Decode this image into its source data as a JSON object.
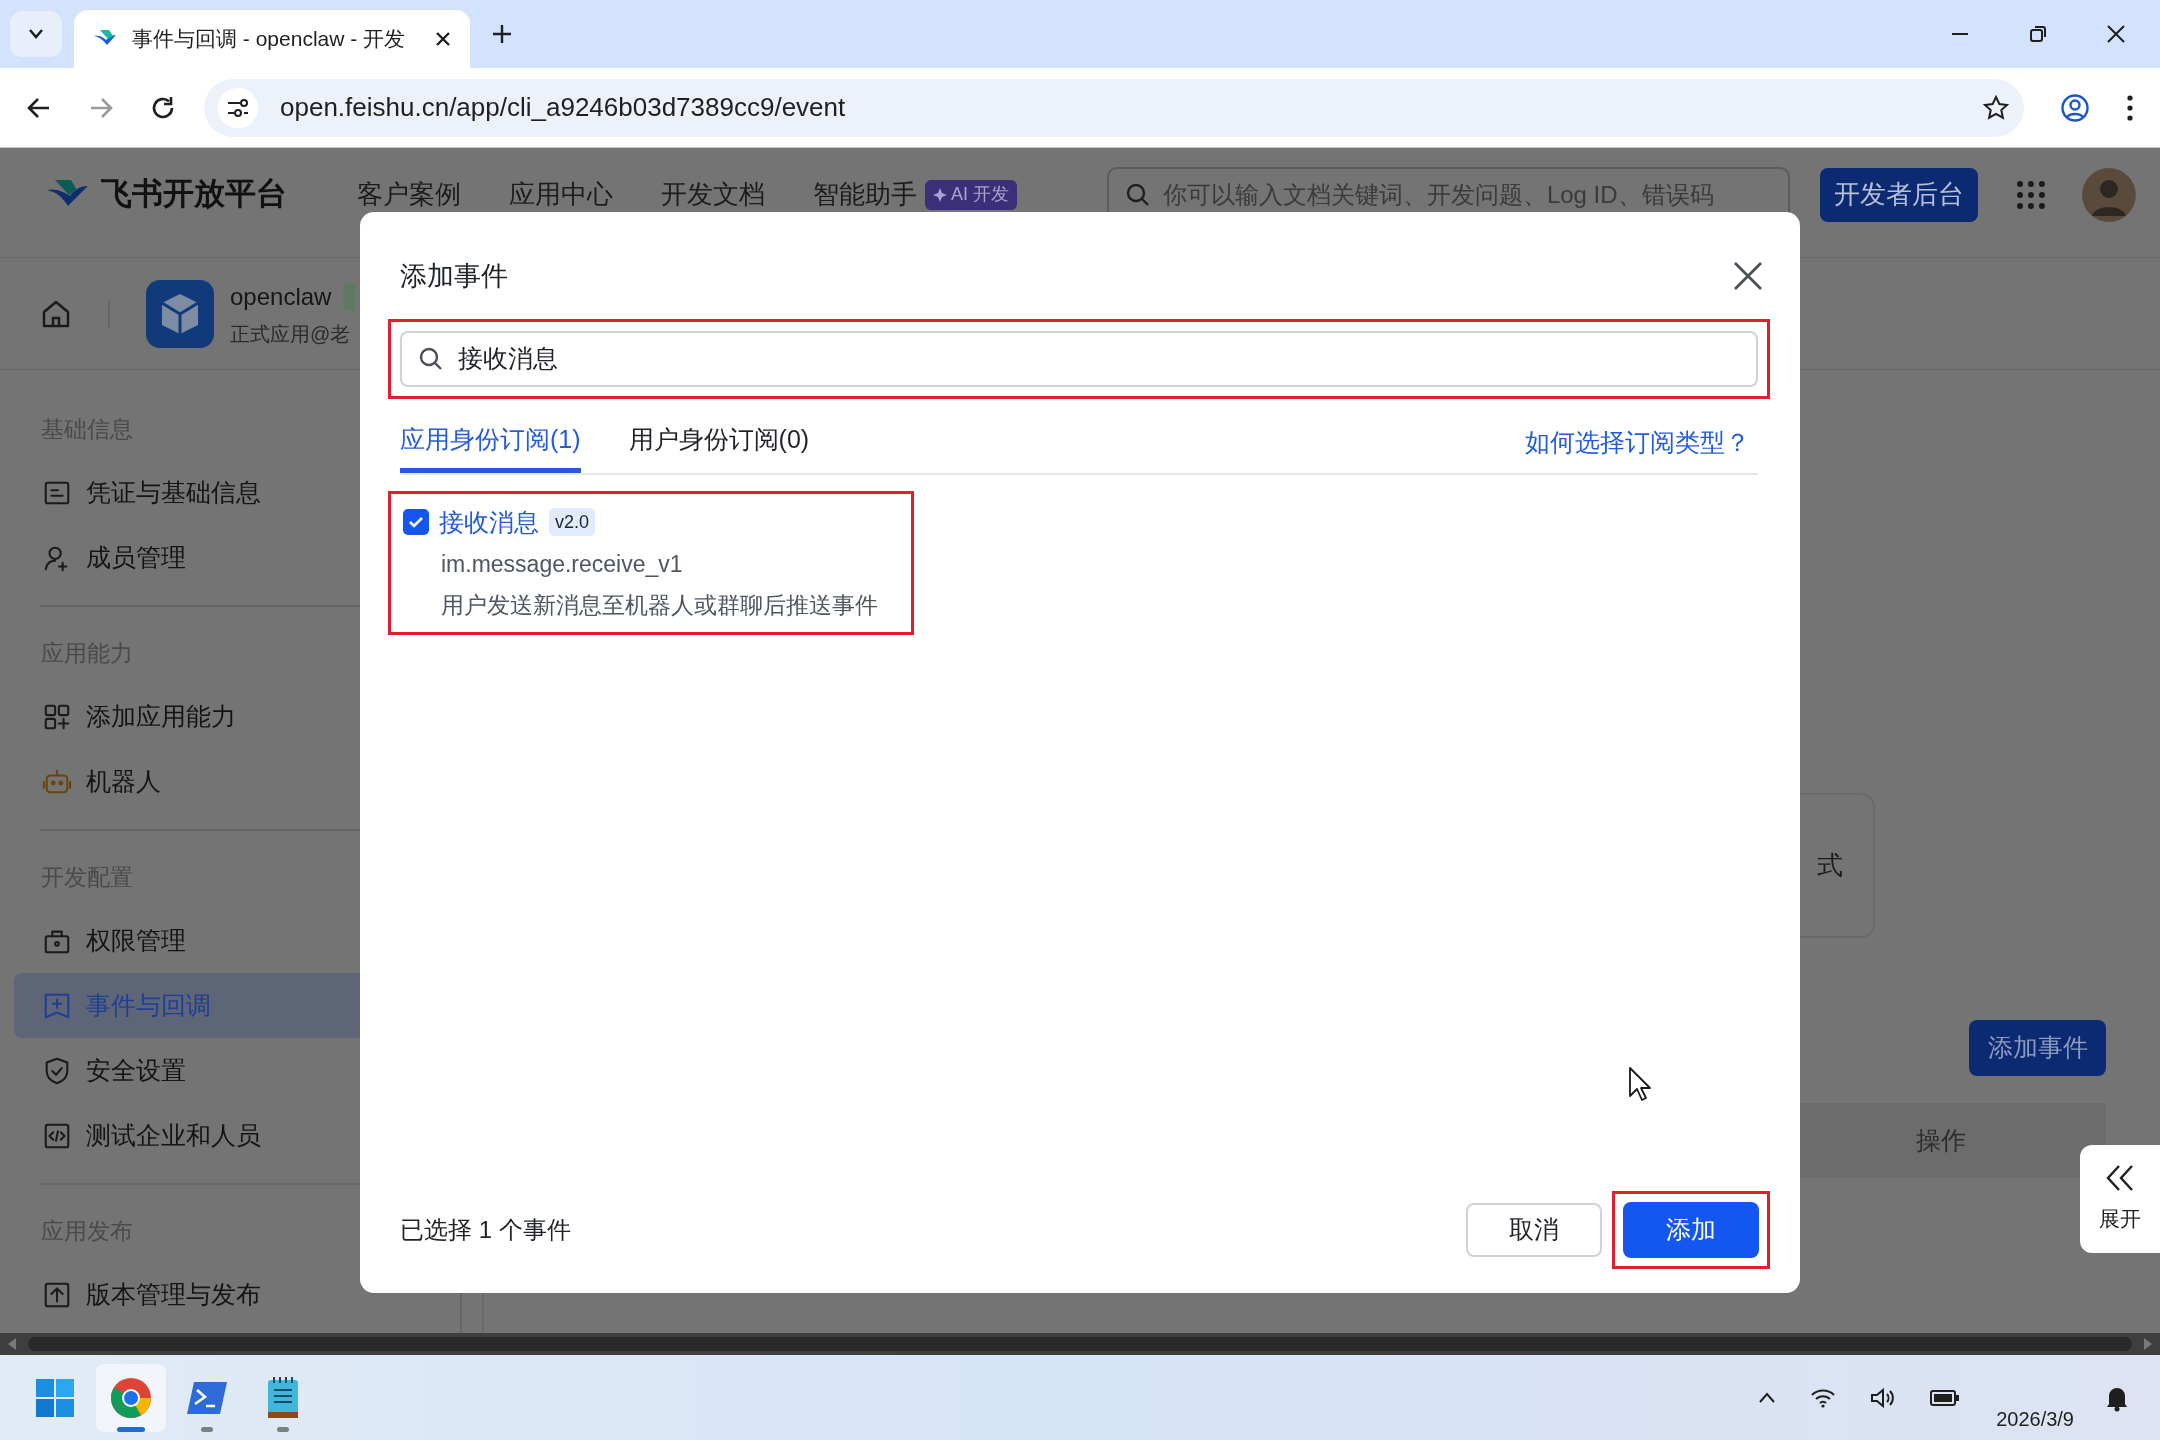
{
  "browser": {
    "tab_title": "事件与回调 - openclaw - 开发",
    "url": "open.feishu.cn/app/cli_a9246b03d7389cc9/event"
  },
  "header": {
    "logo": "飞书开放平台",
    "nav": [
      "客户案例",
      "应用中心",
      "开发文档",
      "智能助手"
    ],
    "ai_badge": "AI 开发",
    "search_placeholder": "你可以输入文档关键词、开发问题、Log ID、错误码",
    "console_button": "开发者后台"
  },
  "app": {
    "name": "openclaw",
    "subtitle": "正式应用@老"
  },
  "sidebar": {
    "sections": [
      {
        "title": "基础信息",
        "items": [
          {
            "label": "凭证与基础信息",
            "kind": "card",
            "selected": false
          },
          {
            "label": "成员管理",
            "kind": "user",
            "selected": false
          }
        ]
      },
      {
        "title": "应用能力",
        "items": [
          {
            "label": "添加应用能力",
            "kind": "grid",
            "selected": false
          },
          {
            "label": "机器人",
            "kind": "robot",
            "selected": false
          }
        ]
      },
      {
        "title": "开发配置",
        "items": [
          {
            "label": "权限管理",
            "kind": "lock",
            "selected": false
          },
          {
            "label": "事件与回调",
            "kind": "event",
            "selected": true
          },
          {
            "label": "安全设置",
            "kind": "shield",
            "selected": false
          },
          {
            "label": "测试企业和人员",
            "kind": "code",
            "selected": false
          }
        ]
      },
      {
        "title": "应用发布",
        "items": [
          {
            "label": "版本管理与发布",
            "kind": "upload",
            "selected": false
          }
        ]
      }
    ]
  },
  "background": {
    "card_text": "式",
    "add_event_button": "添加事件",
    "table_column": "操作",
    "expand_label": "展开"
  },
  "dialog": {
    "title": "添加事件",
    "search": {
      "value": "接收消息",
      "highlighted": true
    },
    "tabs": [
      {
        "label": "应用身份订阅(1)",
        "selected": true
      },
      {
        "label": "用户身份订阅(0)",
        "selected": false
      }
    ],
    "help_link": "如何选择订阅类型？",
    "events": [
      {
        "name": "接收消息",
        "version": "v2.0",
        "key": "im.message.receive_v1",
        "description": "用户发送新消息至机器人或群聊后推送事件",
        "checked": true,
        "highlighted": true
      }
    ],
    "selection_summary": "已选择 1 个事件",
    "cancel_button": "取消",
    "confirm_button": {
      "label": "添加",
      "highlighted": true
    }
  },
  "taskbar": {
    "apps": [
      {
        "kind": "windows",
        "active": false
      },
      {
        "kind": "chrome",
        "active": true
      },
      {
        "kind": "terminal",
        "active": false
      },
      {
        "kind": "notepad",
        "active": false
      }
    ],
    "date": "2026/3/9"
  }
}
